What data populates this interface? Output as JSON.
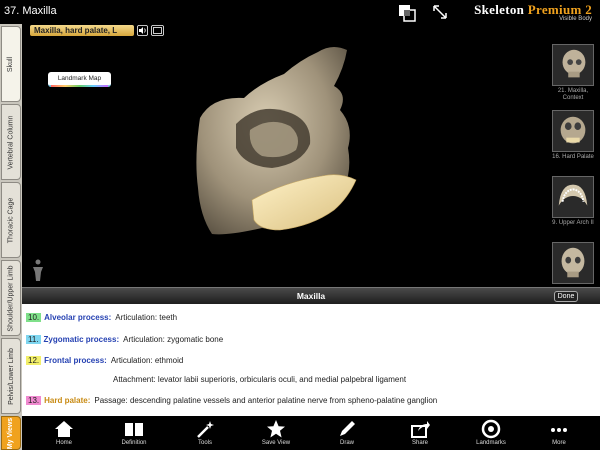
{
  "window": {
    "title": "37. Maxilla"
  },
  "brand": {
    "main": "Skeleton",
    "premium": "Premium",
    "version": "2",
    "sub": "Visible Body"
  },
  "icons": {
    "layers": "layers-icon",
    "expand": "expand-icon",
    "speaker": "speaker-icon",
    "caption": "caption-icon",
    "figure": "figure-icon"
  },
  "tabs": [
    {
      "label": "Skull",
      "active": true
    },
    {
      "label": "Vertebral Column"
    },
    {
      "label": "Thoracic Cage"
    },
    {
      "label": "Shoulder/Upper Limb"
    },
    {
      "label": "Pelvis/Lower Limb"
    },
    {
      "label": "My Views"
    }
  ],
  "structure_label": "Maxilla, hard palate, L",
  "landmark_map": "Landmark Map",
  "thumbnails": [
    {
      "caption": "21. Maxilla, Context"
    },
    {
      "caption": "16. Hard Palate"
    },
    {
      "caption": "9. Upper Arch II"
    },
    {
      "caption": ""
    }
  ],
  "panel": {
    "title": "Maxilla",
    "done": "Done",
    "rows": [
      {
        "num": "10.",
        "color": "#7fe08a",
        "term": "Alveolar process:",
        "desc": "Articulation: teeth"
      },
      {
        "num": "11.",
        "color": "#7fd6f0",
        "term": "Zygomatic process:",
        "desc": "Articulation: zygomatic bone"
      },
      {
        "num": "12.",
        "color": "#f2ef6a",
        "term": "Frontal process:",
        "desc": "Articulation: ethmoid"
      },
      {
        "num": "",
        "color": "",
        "term": "",
        "desc": "Attachment: levator labii superioris, orbicularis oculi, and medial palpebral ligament"
      },
      {
        "num": "13.",
        "color": "#f08ad0",
        "term": "Hard palate:",
        "desc": "Passage: descending palatine vessels and anterior palatine nerve from spheno-palatine ganglion"
      }
    ]
  },
  "toolbar": [
    {
      "label": "Home",
      "icon": "home-icon"
    },
    {
      "label": "Definition",
      "icon": "book-icon"
    },
    {
      "label": "Tools",
      "icon": "wand-icon"
    },
    {
      "label": "Save View",
      "icon": "star-icon"
    },
    {
      "label": "Draw",
      "icon": "pencil-icon"
    },
    {
      "label": "Share",
      "icon": "share-icon"
    },
    {
      "label": "Landmarks",
      "icon": "target-icon"
    },
    {
      "label": "More",
      "icon": "more-icon"
    }
  ]
}
